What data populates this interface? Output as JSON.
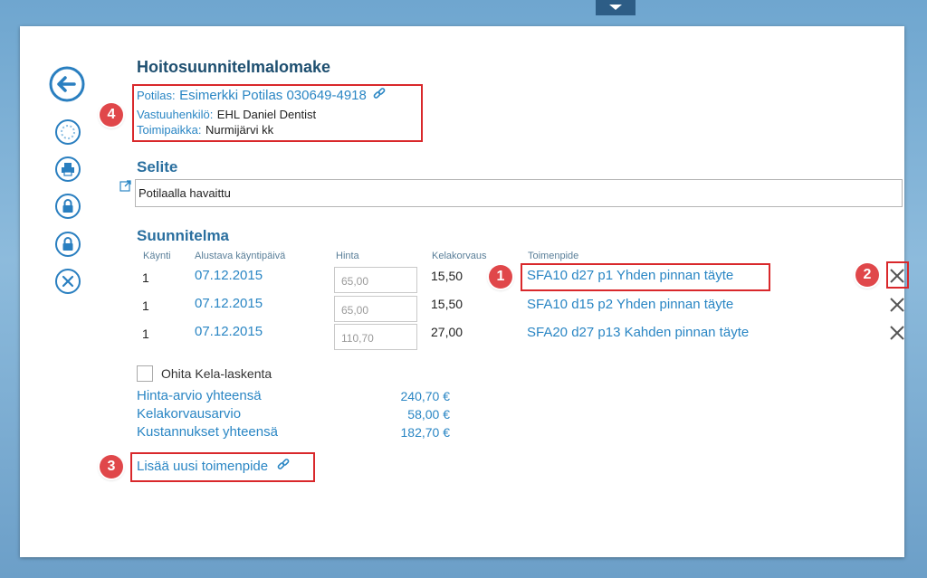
{
  "form": {
    "title": "Hoitosuunnitelmalomake",
    "patient_label": "Potilas:",
    "patient_value": "Esimerkki Potilas 030649-4918",
    "responsible_label": "Vastuuhenkilö:",
    "responsible_value": "EHL Daniel Dentist",
    "location_label": "Toimipaikka:",
    "location_value": "Nurmijärvi kk"
  },
  "selite": {
    "title": "Selite",
    "text": "Potilaalla havaittu"
  },
  "plan": {
    "title": "Suunnitelma",
    "headers": {
      "visit": "Käynti",
      "date": "Alustava käyntipäivä",
      "price": "Hinta",
      "kela": "Kelakorvaus",
      "procedure": "Toimenpide"
    },
    "rows": [
      {
        "visit": "1",
        "date": "07.12.2015",
        "price": "65,00",
        "kela": "15,50",
        "procedure": "SFA10 d27 p1 Yhden pinnan täyte"
      },
      {
        "visit": "1",
        "date": "07.12.2015",
        "price": "65,00",
        "kela": "15,50",
        "procedure": "SFA10 d15 p2 Yhden pinnan täyte"
      },
      {
        "visit": "1",
        "date": "07.12.2015",
        "price": "110,70",
        "kela": "27,00",
        "procedure": "SFA20 d27 p13 Kahden pinnan täyte"
      }
    ]
  },
  "options": {
    "skip_kela_label": "Ohita Kela-laskenta",
    "skip_kela_checked": false
  },
  "totals": {
    "price_label": "Hinta-arvio yhteensä",
    "price_value": "240,70 €",
    "kela_label": "Kelakorvausarvio",
    "kela_value": "58,00 €",
    "cost_label": "Kustannukset yhteensä",
    "cost_value": "182,70 €"
  },
  "actions": {
    "add_procedure": "Lisää uusi toimenpide"
  },
  "annotations": {
    "badge_1": "1",
    "badge_2": "2",
    "badge_3": "3",
    "badge_4": "4"
  },
  "toolbar": {
    "icons": [
      "back-arrow-icon",
      "loading-icon",
      "print-icon",
      "lock-icon",
      "lock-icon",
      "close-circle-icon"
    ]
  },
  "colors": {
    "accent": "#2a86c4",
    "heading": "#1e4f70",
    "annotation_red": "#d9282b",
    "background": "#7fb0d6"
  }
}
